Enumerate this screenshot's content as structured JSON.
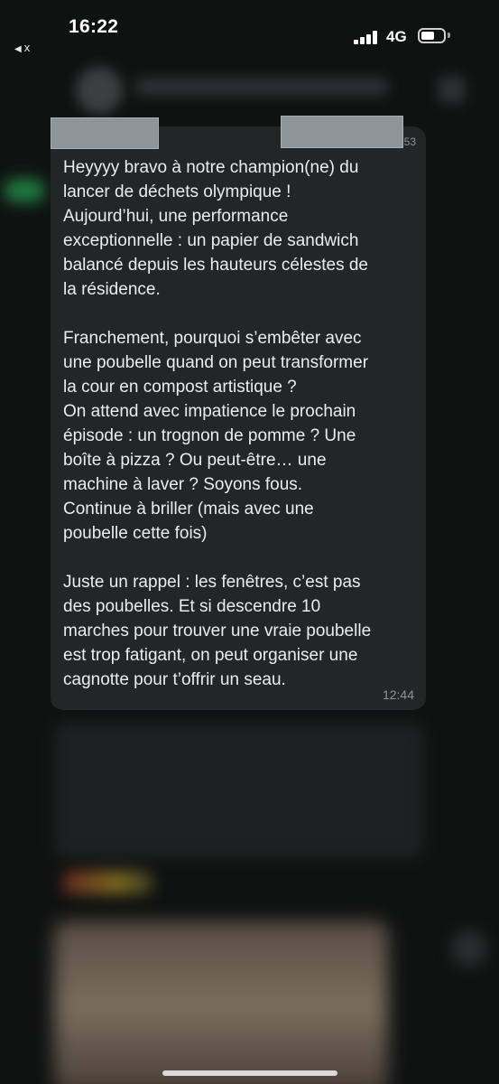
{
  "status_bar": {
    "time": "16:22",
    "back_label": "x",
    "network": "4G",
    "battery_level_percent": 60
  },
  "message": {
    "header_time_fragment": "53",
    "text": "Heyyyy bravo à notre champion(ne) du\nlancer de déchets olympique !\nAujourd’hui, une performance\nexceptionnelle : un papier de sandwich\nbalancé depuis les hauteurs célestes de\nla résidence.\n\nFranchement, pourquoi s’embêter avec\nune poubelle quand on peut transformer\nla cour en compost artistique ?\nOn attend avec impatience le prochain\népisode : un trognon de pomme ? Une\nboîte à pizza ? Ou peut-être… une\nmachine à laver ? Soyons fous.\nContinue à briller (mais avec une\npoubelle cette fois)\n\nJuste un rappel : les fenêtres, c’est pas\ndes poubelles. Et si descendre 10\nmarches pour trouver une vraie poubelle\nest trop fatigant, on peut organiser une\ncagnotte pour t’offrir un seau.",
    "time": "12:44"
  },
  "colors": {
    "bubble_bg": "#232626",
    "screen_bg": "#101212",
    "text": "#e9edef",
    "meta_text": "#8c9395",
    "redaction": "#8e9599"
  }
}
